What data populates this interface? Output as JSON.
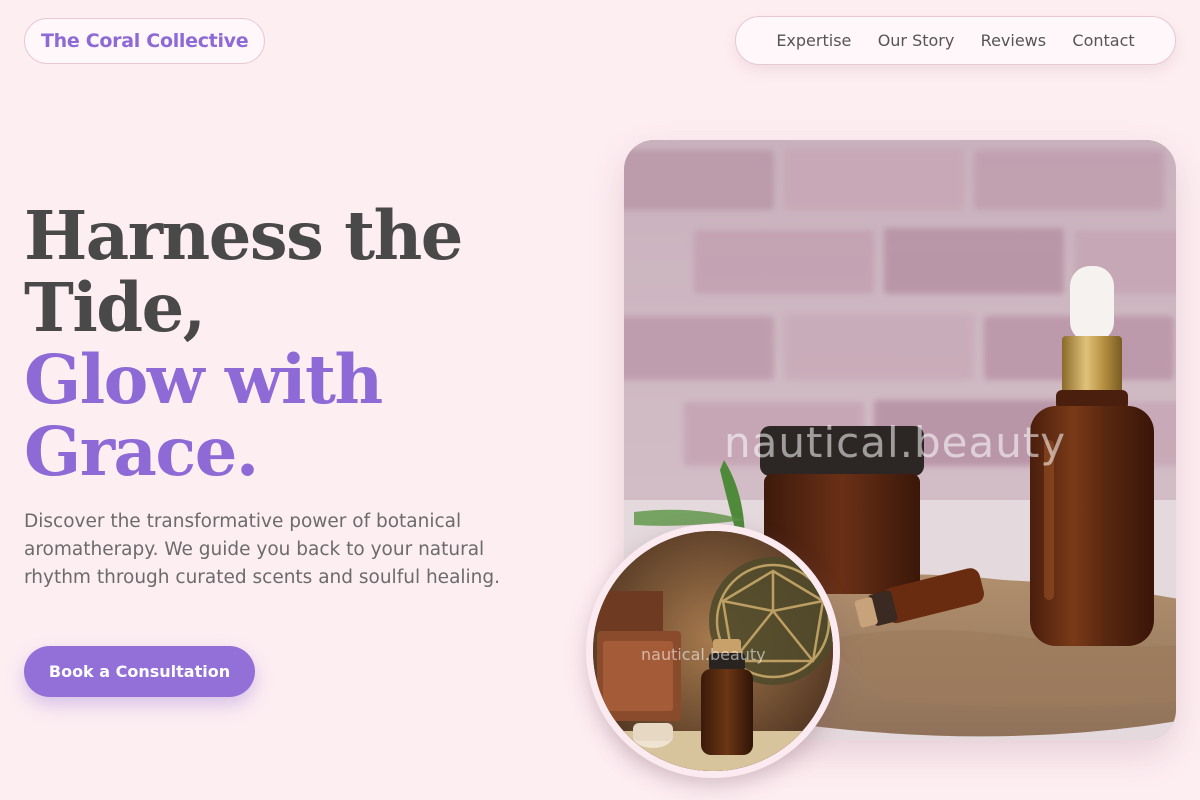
{
  "brand": {
    "name": "The Coral Collective"
  },
  "nav": {
    "items": [
      {
        "label": "Expertise"
      },
      {
        "label": "Our Story"
      },
      {
        "label": "Reviews"
      },
      {
        "label": "Contact"
      }
    ]
  },
  "hero": {
    "title_line1": "Harness the Tide,",
    "title_line2": "Glow with Grace.",
    "description": "Discover the transformative power of botanical aromatherapy. We guide you back to your natural rhythm through curated scents and soulful healing.",
    "cta_label": "Book a Consultation"
  },
  "images": {
    "main_watermark": "nautical.beauty",
    "circle_watermark": "nautical.beauty"
  },
  "colors": {
    "background": "#fdeef2",
    "accent": "#8d6ad6",
    "heading": "#494949",
    "text": "#6b6b6b"
  }
}
